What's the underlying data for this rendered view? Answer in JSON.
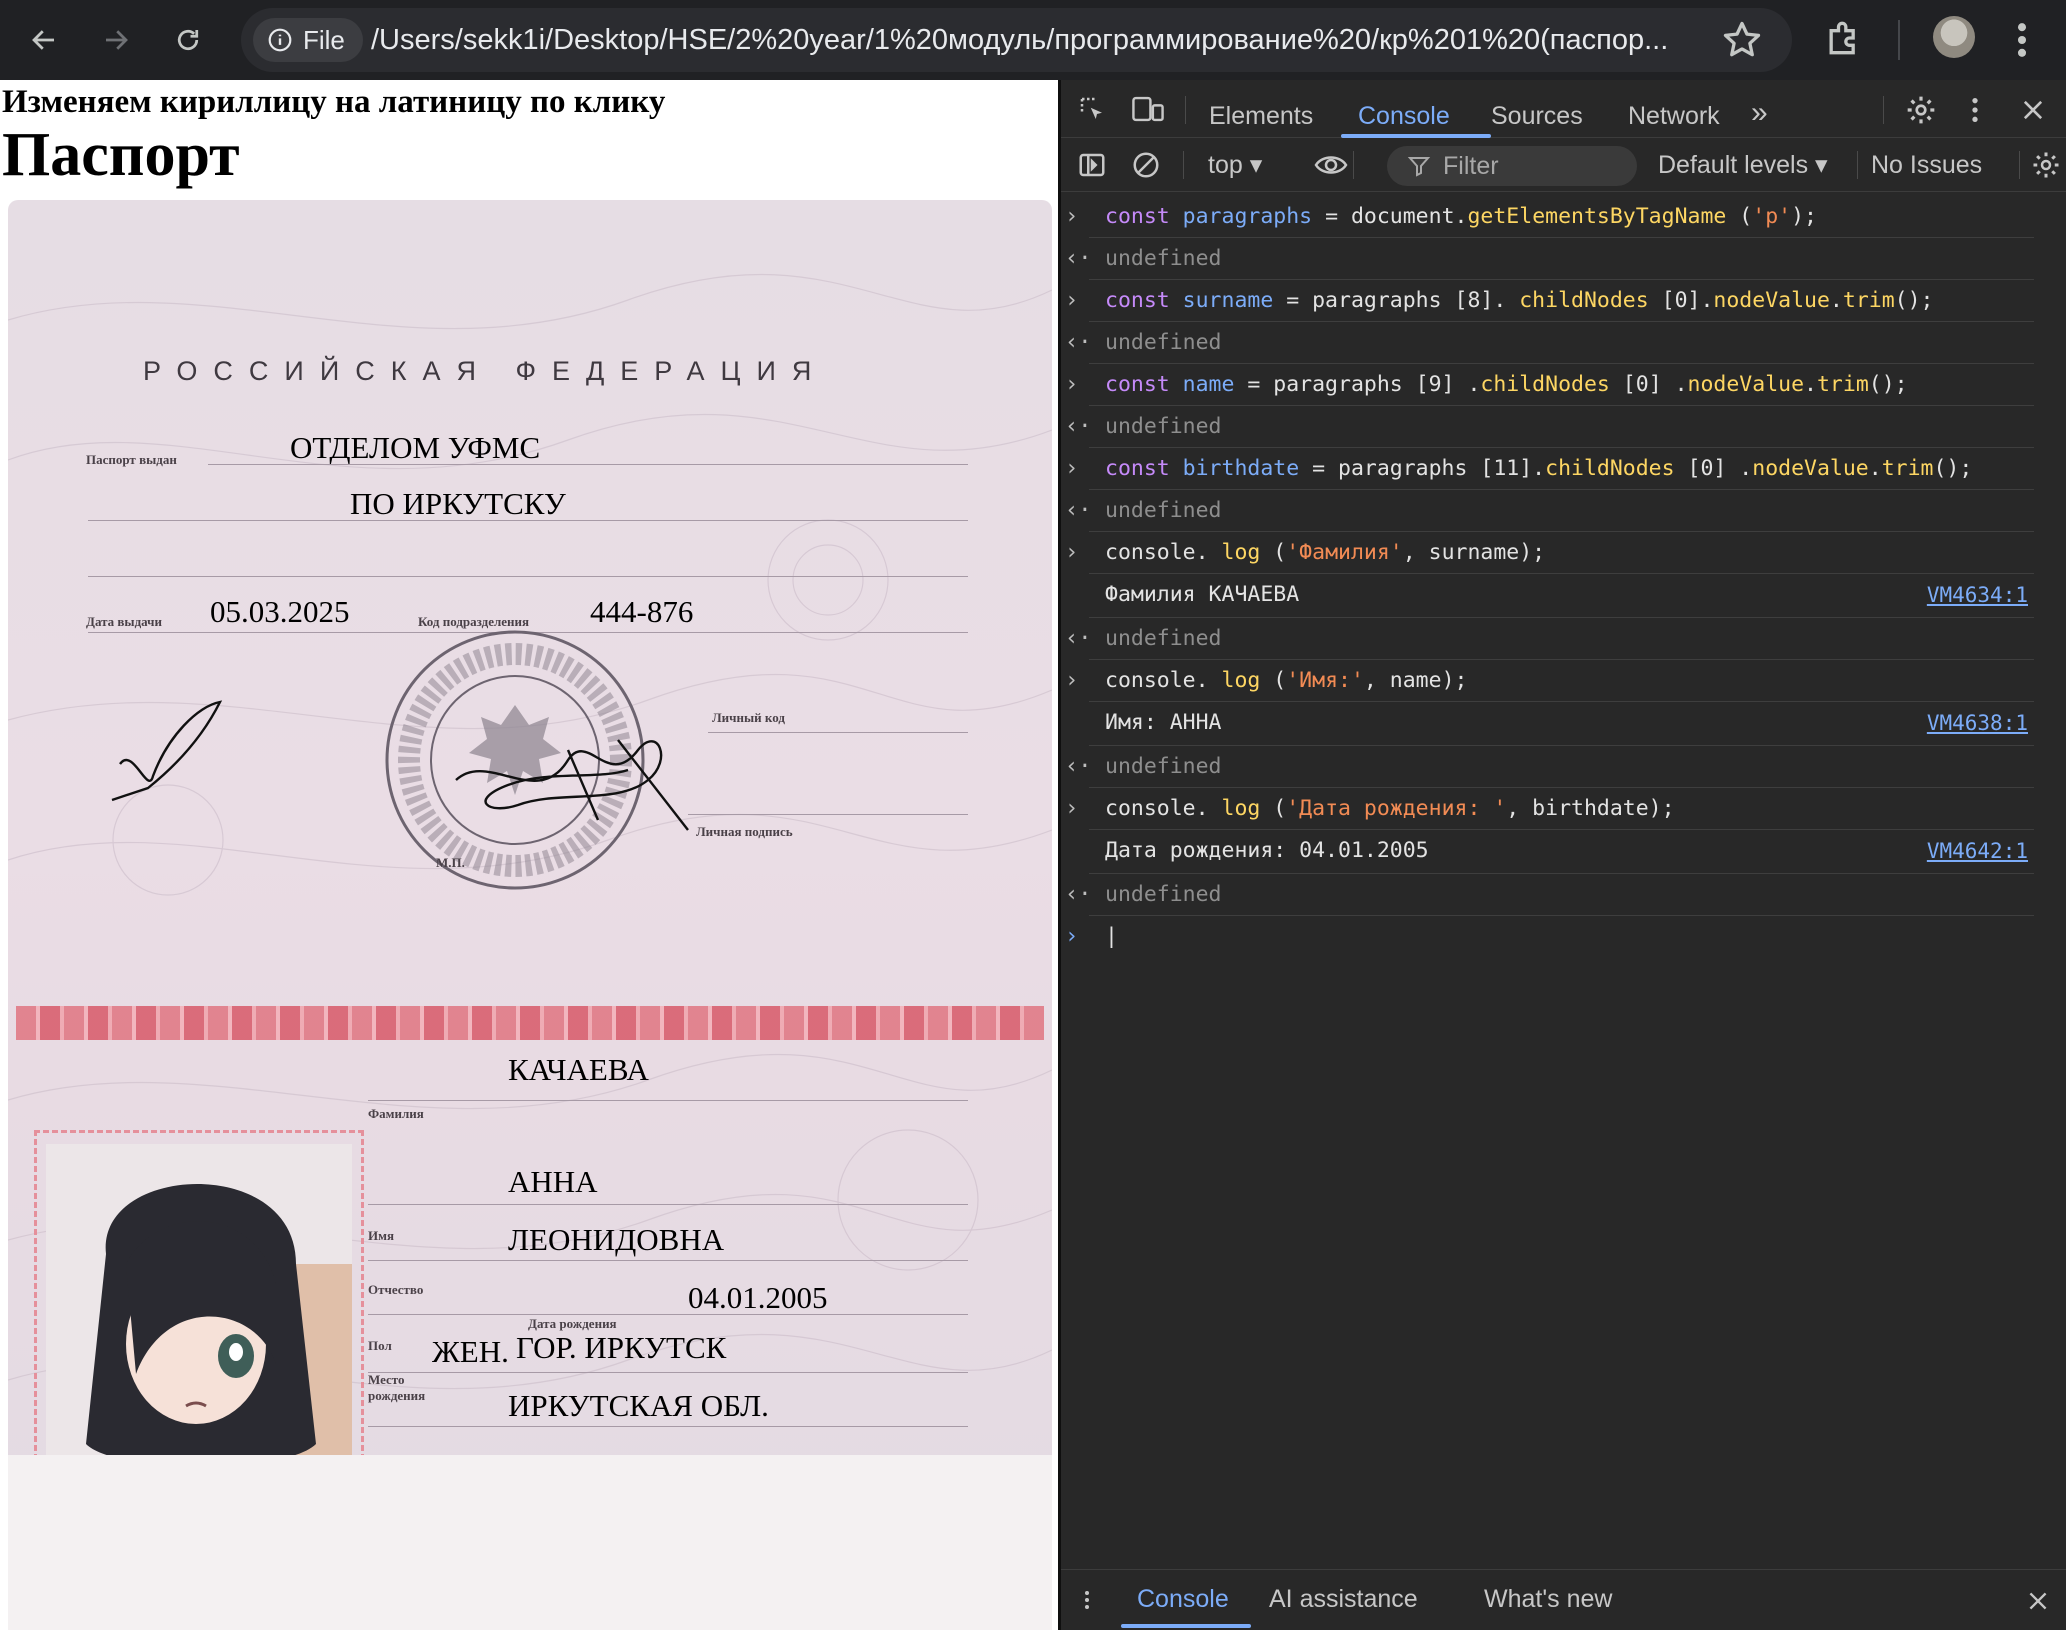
{
  "browser": {
    "chip_label": "File",
    "url": "/Users/sekk1i/Desktop/HSE/2%20year/1%20модуль/программирование%20/кр%201%20(паспор..."
  },
  "page": {
    "heading_small": "Изменяем кириллицу на латиницу по клику",
    "heading_large": "Паспорт"
  },
  "passport": {
    "country": "РОССИЙСКАЯ ФЕДЕРАЦИЯ",
    "issued_by_label": "Паспорт выдан",
    "issued_by_line1": "ОТДЕЛОМ УФМС",
    "issued_by_line2": "ПО   ИРКУТСКУ",
    "issue_date_label": "Дата выдачи",
    "issue_date": "05.03.2025",
    "dept_code_label": "Код подразделения",
    "dept_code": "444-876",
    "personal_code_label": "Личный код",
    "personal_signature_label": "Личная подпись",
    "mp_label": "М.П.",
    "surname_label": "Фамилия",
    "surname": "КАЧАЕВА",
    "name_label": "Имя",
    "name": "АННА",
    "patronymic_label": "Отчество",
    "patronymic": "ЛЕОНИДОВНА",
    "birth_date_label": "Дата рождения",
    "birth_date": "04.01.2005",
    "sex_label": "Пол",
    "sex": "ЖЕН.",
    "birth_place_label": "Место рождения",
    "birth_place_line1": "ГОР.   ИРКУТСК",
    "birth_place_line2": "ИРКУТСКАЯ ОБЛ."
  },
  "devtools": {
    "tabs": [
      "Elements",
      "Console",
      "Sources",
      "Network"
    ],
    "active_tab": "Console",
    "more_tabs": "»",
    "context": "top ▾",
    "filter_placeholder": "Filter",
    "levels": "Default levels ▾",
    "issues": "No Issues",
    "console_lines": [
      {
        "kind": "input",
        "tokens": [
          [
            "kw",
            "const "
          ],
          [
            "var",
            "paragraphs"
          ],
          [
            "plain",
            " = document."
          ],
          [
            "fn",
            "getElementsByTagName"
          ],
          [
            "plain",
            " ("
          ],
          [
            "str",
            "'p'"
          ],
          [
            "plain",
            ");"
          ]
        ]
      },
      {
        "kind": "return",
        "tokens": [
          [
            "und",
            "undefined"
          ]
        ]
      },
      {
        "kind": "input",
        "tokens": [
          [
            "kw",
            "const "
          ],
          [
            "var",
            "surname"
          ],
          [
            "plain",
            " = paragraphs [8]. "
          ],
          [
            "fn",
            "childNodes"
          ],
          [
            "plain",
            " [0]."
          ],
          [
            "fn",
            "nodeValue"
          ],
          [
            "plain",
            "."
          ],
          [
            "fn",
            "trim"
          ],
          [
            "plain",
            "();"
          ]
        ]
      },
      {
        "kind": "return",
        "tokens": [
          [
            "und",
            "undefined"
          ]
        ]
      },
      {
        "kind": "input",
        "tokens": [
          [
            "kw",
            "const "
          ],
          [
            "var",
            "name"
          ],
          [
            "plain",
            " = paragraphs [9] ."
          ],
          [
            "fn",
            "childNodes"
          ],
          [
            "plain",
            " [0] ."
          ],
          [
            "fn",
            "nodeValue"
          ],
          [
            "plain",
            "."
          ],
          [
            "fn",
            "trim"
          ],
          [
            "plain",
            "();"
          ]
        ]
      },
      {
        "kind": "return",
        "tokens": [
          [
            "und",
            "undefined"
          ]
        ]
      },
      {
        "kind": "input",
        "tokens": [
          [
            "kw",
            "const "
          ],
          [
            "var",
            "birthdate"
          ],
          [
            "plain",
            " = paragraphs [11]."
          ],
          [
            "fn",
            "childNodes"
          ],
          [
            "plain",
            " [0] ."
          ],
          [
            "fn",
            "nodeValue"
          ],
          [
            "plain",
            "."
          ],
          [
            "fn",
            "trim"
          ],
          [
            "plain",
            "();"
          ]
        ]
      },
      {
        "kind": "return",
        "tokens": [
          [
            "und",
            "undefined"
          ]
        ]
      },
      {
        "kind": "input",
        "tokens": [
          [
            "plain",
            "console. "
          ],
          [
            "fn",
            "log"
          ],
          [
            "plain",
            " ("
          ],
          [
            "str",
            "'Фамилия'"
          ],
          [
            "plain",
            ", surname);"
          ]
        ]
      },
      {
        "kind": "output",
        "tokens": [
          [
            "plain",
            "Фамилия КАЧАЕВА"
          ]
        ],
        "source": "VM4634:1"
      },
      {
        "kind": "return",
        "tokens": [
          [
            "und",
            "undefined"
          ]
        ]
      },
      {
        "kind": "input",
        "tokens": [
          [
            "plain",
            "console. "
          ],
          [
            "fn",
            "log"
          ],
          [
            "plain",
            " ("
          ],
          [
            "str",
            "'Имя:'"
          ],
          [
            "plain",
            ", name);"
          ]
        ]
      },
      {
        "kind": "output",
        "tokens": [
          [
            "plain",
            "Имя: АННА"
          ]
        ],
        "source": "VM4638:1"
      },
      {
        "kind": "return",
        "tokens": [
          [
            "und",
            "undefined"
          ]
        ]
      },
      {
        "kind": "input",
        "tokens": [
          [
            "plain",
            "console. "
          ],
          [
            "fn",
            "log"
          ],
          [
            "plain",
            " ("
          ],
          [
            "str",
            "'Дата рождения: '"
          ],
          [
            "plain",
            ", birthdate);"
          ]
        ]
      },
      {
        "kind": "output",
        "tokens": [
          [
            "plain",
            "Дата рождения:  04.01.2005"
          ]
        ],
        "source": "VM4642:1"
      },
      {
        "kind": "return",
        "tokens": [
          [
            "und",
            "undefined"
          ]
        ]
      },
      {
        "kind": "prompt",
        "tokens": [
          [
            "plain",
            "|"
          ]
        ]
      }
    ],
    "drawer_tabs": [
      "Console",
      "AI assistance",
      "What's new"
    ],
    "drawer_active": "Console"
  },
  "colors": {
    "chrome_bg": "#202124",
    "devtools_bg": "#282828",
    "accent": "#7cacf8",
    "keyword": "#c58af9",
    "function": "#fdd663",
    "string": "#f28b54"
  }
}
